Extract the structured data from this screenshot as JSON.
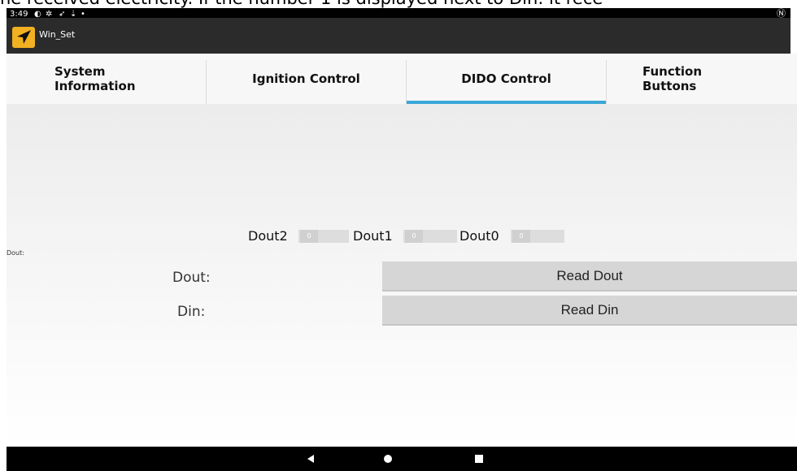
{
  "overlay_text": "he received electricity. If the number 1 is displayed next to Din: it rece",
  "status": {
    "time": "3:49",
    "icons": [
      "sync-icon",
      "settings-icon",
      "location-icon",
      "download-icon",
      "dot-icon",
      "nfc-icon"
    ]
  },
  "app": {
    "title": "Win_Set",
    "logo_icon": "navigation-arrow-icon"
  },
  "tabs": [
    {
      "label": "System\nInformation"
    },
    {
      "label": "Ignition Control"
    },
    {
      "label": "DIDO Control",
      "selected": true
    },
    {
      "label": "Function\nButtons"
    }
  ],
  "dido": {
    "outputs": [
      {
        "label": "Dout2",
        "value": "0"
      },
      {
        "label": "Dout1",
        "value": "0"
      },
      {
        "label": "Dout0",
        "value": "0"
      }
    ],
    "small_label": "Dout:",
    "dout_label": "Dout:",
    "din_label": "Din:",
    "read_dout": "Read Dout",
    "read_din": "Read Din"
  },
  "colors": {
    "accent": "#3aa7d8",
    "tab_underline": "#66c0dd",
    "logo": "#f2b120",
    "button": "#d6d6d6"
  }
}
